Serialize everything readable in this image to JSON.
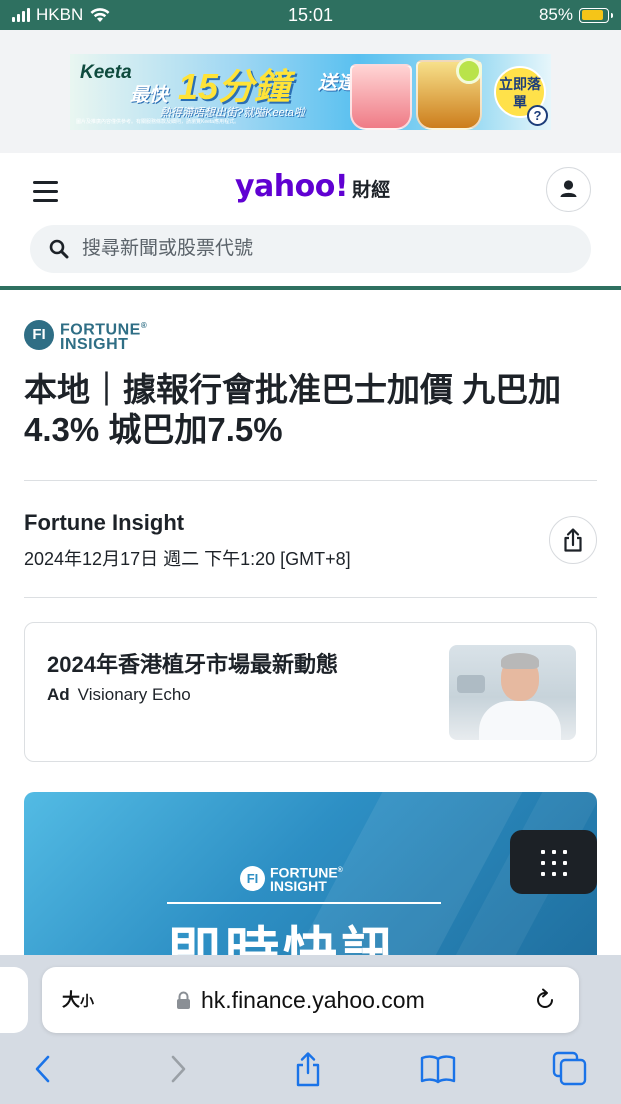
{
  "status_bar": {
    "carrier": "HKBN",
    "time": "15:01",
    "battery": "85%",
    "battery_level": 0.85
  },
  "ad_banner": {
    "brand": "Keeta",
    "prefix": "最快",
    "minutes": "15分鐘",
    "suffix": "送達",
    "subline": "熱得滯唔想出街?就嗌Keeta啦",
    "cta": "立即落單",
    "info": "?",
    "fine_print": "圖片及推廣內容僅供參考。有關服務條款及細則，請瀏覽Keeta應用程式。"
  },
  "header": {
    "brand_word": "yahoo!",
    "brand_sub": "財經",
    "search_placeholder": "搜尋新聞或股票代號"
  },
  "article": {
    "source_logo_mark": "FI",
    "source_logo_line1": "FORTUNE",
    "source_logo_reg": "®",
    "source_logo_line2": "INSIGHT",
    "headline": "本地｜據報行會批准巴士加價 九巴加4.3% 城巴加7.5%",
    "author": "Fortune Insight",
    "datetime": "2024年12月17日 週二 下午1:20 [GMT+8]"
  },
  "sponsored": {
    "title": "2024年香港植牙市場最新動態",
    "label": "Ad",
    "advertiser": "Visionary Echo"
  },
  "hero": {
    "logo_mark": "FI",
    "logo_line1": "FORTUNE",
    "logo_reg": "®",
    "logo_line2": "INSIGHT",
    "title": "即時快訊"
  },
  "safari": {
    "text_size_label": "大",
    "text_size_small": "小",
    "url": "hk.finance.yahoo.com"
  },
  "icons": {
    "menu": "hamburger-icon",
    "profile": "user-icon",
    "search": "search-icon",
    "share": "share-icon",
    "grid": "grid-icon",
    "lock": "lock-icon",
    "reload": "reload-icon",
    "back": "chevron-left-icon",
    "forward": "chevron-right-icon",
    "bookmarks": "book-icon",
    "tabs": "tabs-icon"
  },
  "colors": {
    "status_bar": "#2e7060",
    "brand_purple": "#6001d2",
    "safari_blue": "#1a73e8"
  }
}
